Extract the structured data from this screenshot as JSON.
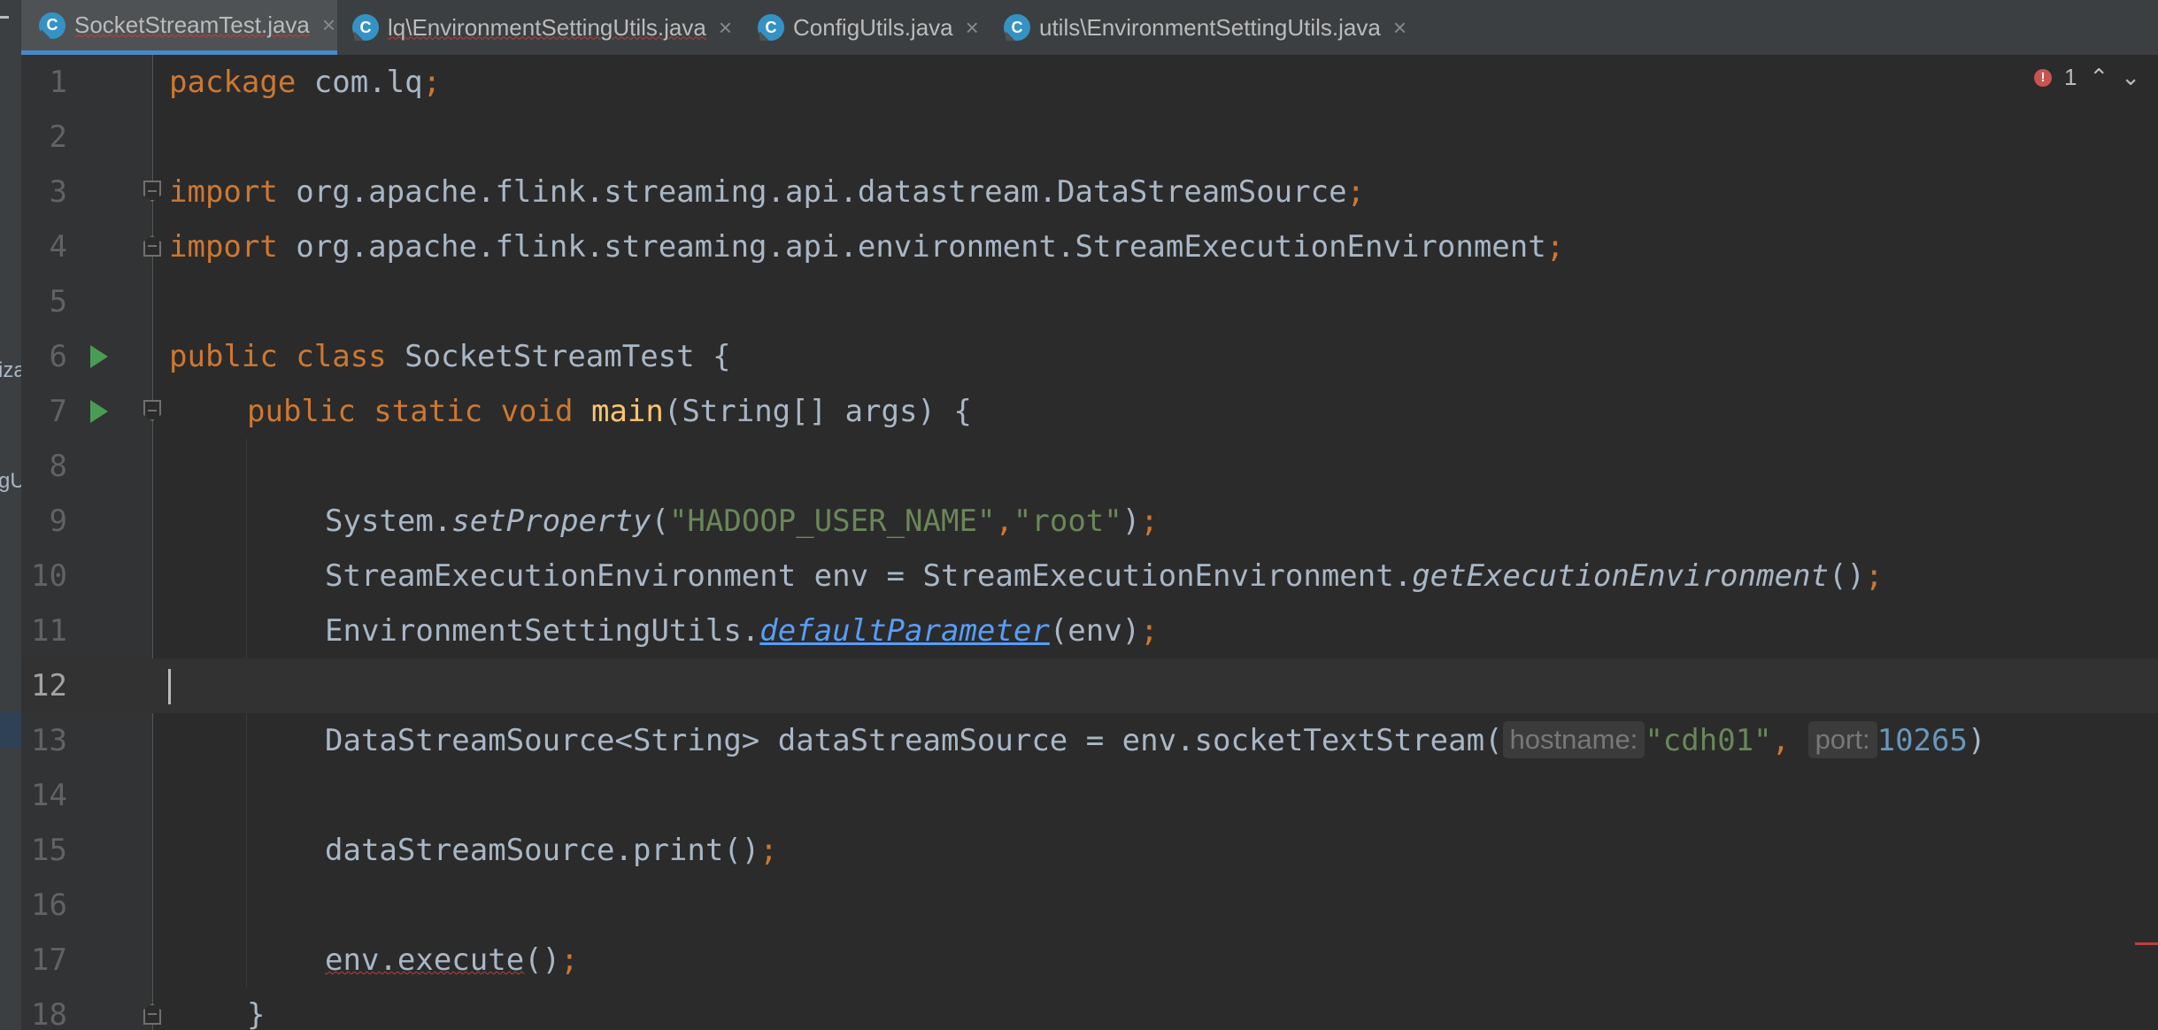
{
  "tabs": [
    {
      "label": "SocketStreamTest.java",
      "active": true,
      "error": true
    },
    {
      "label": "lq\\EnvironmentSettingUtils.java",
      "active": false,
      "error": true
    },
    {
      "label": "ConfigUtils.java",
      "active": false,
      "error": false
    },
    {
      "label": "utils\\EnvironmentSettingUtils.java",
      "active": false,
      "error": false
    }
  ],
  "tab_icon_letter": "C",
  "tab_close_glyph": "×",
  "left_panel_fragments": [
    "iza",
    "gU"
  ],
  "inspection": {
    "error_count": "1",
    "up_glyph": "⌃",
    "down_glyph": "⌄"
  },
  "editor": {
    "current_line": 12,
    "line_numbers": [
      "1",
      "2",
      "3",
      "4",
      "5",
      "6",
      "7",
      "8",
      "9",
      "10",
      "11",
      "12",
      "13",
      "14",
      "15",
      "16",
      "17",
      "18"
    ],
    "code": {
      "l1_kw": "package",
      "l1_rest": " com.lq",
      "l1_semi": ";",
      "l3_kw": "import",
      "l3_rest": " org.apache.flink.streaming.api.datastream.DataStreamSource",
      "l3_semi": ";",
      "l4_kw": "import",
      "l4_rest": " org.apache.flink.streaming.api.environment.StreamExecutionEnvironment",
      "l4_semi": ";",
      "l6_kw": "public class",
      "l6_rest": " SocketStreamTest {",
      "l7_kw": "public static void",
      "l7_fn": "main",
      "l7_rest": "(String[] args) {",
      "l9_obj": "System.",
      "l9_method": "setProperty",
      "l9_open": "(",
      "l9_str1": "\"HADOOP_USER_NAME\"",
      "l9_comma": ",",
      "l9_str2": "\"root\"",
      "l9_close": ")",
      "l9_semi": ";",
      "l10_start": "StreamExecutionEnvironment env = StreamExecutionEnvironment.",
      "l10_method": "getExecutionEnvironment",
      "l10_end": "()",
      "l10_semi": ";",
      "l11_obj": "EnvironmentSettingUtils.",
      "l11_method": "defaultParameter",
      "l11_end": "(env)",
      "l11_semi": ";",
      "l13_start": "DataStreamSource<String> dataStreamSource = env.socketTextStream(",
      "l13_hint1": "hostname:",
      "l13_str": "\"cdh01\"",
      "l13_comma": ", ",
      "l13_hint2": "port:",
      "l13_num": "10265",
      "l13_end": ")",
      "l15_start": "dataStreamSource.print()",
      "l15_semi": ";",
      "l17_squig": "env.execute",
      "l17_end": "()",
      "l17_semi": ";",
      "l18_rest": "}"
    }
  },
  "colors": {
    "keyword": "#cc7832",
    "string": "#6a8759",
    "number": "#6897bb",
    "function": "#ffc66d",
    "link": "#589df6",
    "text": "#a9b7c6",
    "run": "#499c54",
    "error": "#bc3f3c",
    "tab_underline": "#4a88c7"
  },
  "icons": {
    "tab_file": "java-class-icon",
    "run": "run-icon",
    "fold": "fold-icon",
    "error": "error-icon",
    "close": "close-icon"
  }
}
